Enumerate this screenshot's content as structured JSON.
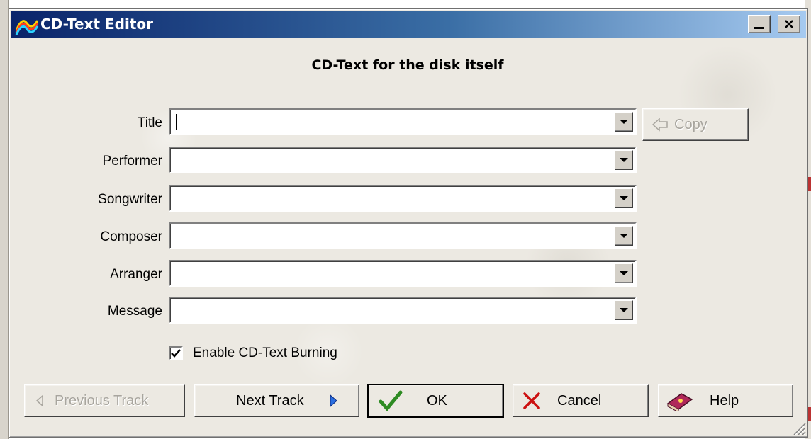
{
  "window": {
    "title": "CD-Text Editor",
    "heading": "CD-Text for the disk itself"
  },
  "fields": [
    {
      "label": "Title",
      "value": ""
    },
    {
      "label": "Performer",
      "value": ""
    },
    {
      "label": "Songwriter",
      "value": ""
    },
    {
      "label": "Composer",
      "value": ""
    },
    {
      "label": "Arranger",
      "value": ""
    },
    {
      "label": "Message",
      "value": ""
    }
  ],
  "copy_button": {
    "label": "Copy",
    "enabled": false
  },
  "enable_burning": {
    "label": "Enable CD-Text Burning",
    "checked": true
  },
  "buttons": {
    "previous": "Previous Track",
    "next": "Next Track",
    "ok": "OK",
    "cancel": "Cancel",
    "help": "Help"
  },
  "colors": {
    "title_bar_start": "#0a246a",
    "title_bar_end": "#a6caf0",
    "ok_check": "#2e8b23",
    "cancel_x": "#cc1111"
  },
  "icons": {
    "app": "cd-text-app-icon",
    "copy": "arrow-left-outline-icon",
    "previous": "triangle-left-icon",
    "next": "triangle-right-icon",
    "ok": "checkmark-icon",
    "cancel": "x-icon",
    "help": "help-book-icon"
  }
}
